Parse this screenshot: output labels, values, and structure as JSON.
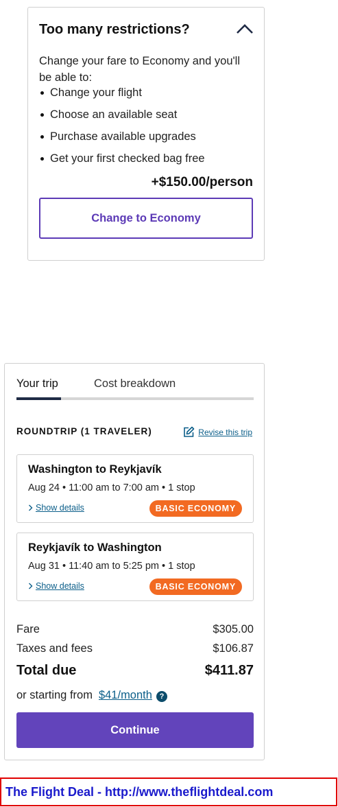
{
  "restrictions": {
    "title": "Too many restrictions?",
    "intro": "Change your fare to Economy and you'll be able to:",
    "benefits": [
      "Change your flight",
      "Choose an available seat",
      "Purchase available upgrades",
      "Get your first checked bag free"
    ],
    "price": "+$150.00/person",
    "button_label": "Change to Economy"
  },
  "trip": {
    "tabs": [
      "Your trip",
      "Cost breakdown"
    ],
    "active_tab": "Your trip",
    "roundtrip_label": "ROUNDTRIP (1 TRAVELER)",
    "revise_label": "Revise this trip",
    "flights": [
      {
        "route": "Washington to Reykjavík",
        "details": "Aug 24 • 11:00 am to 7:00 am • 1 stop",
        "show_details": "Show details",
        "fare_class": "BASIC ECONOMY"
      },
      {
        "route": "Reykjavík to Washington",
        "details": "Aug 31 • 11:40 am to 5:25 pm • 1 stop",
        "show_details": "Show details",
        "fare_class": "BASIC ECONOMY"
      }
    ],
    "fare_label": "Fare",
    "fare_value": "$305.00",
    "taxes_label": "Taxes and fees",
    "taxes_value": "$106.87",
    "total_label": "Total due",
    "total_value": "$411.87",
    "starting_label": "or starting from",
    "monthly_amount": "$41/month",
    "help_glyph": "?",
    "continue_label": "Continue"
  },
  "watermark": {
    "text": "The Flight Deal - http://www.theflightdeal.com"
  },
  "colors": {
    "accent_purple": "#6244bb",
    "badge_orange": "#f26a22",
    "link_blue": "#0b5e89",
    "tab_active": "#1f2b45"
  },
  "icons": {
    "collapse": "chevron-up-icon",
    "revise": "edit-icon",
    "show_details": "chevron-right-icon",
    "help": "question-mark-icon"
  }
}
